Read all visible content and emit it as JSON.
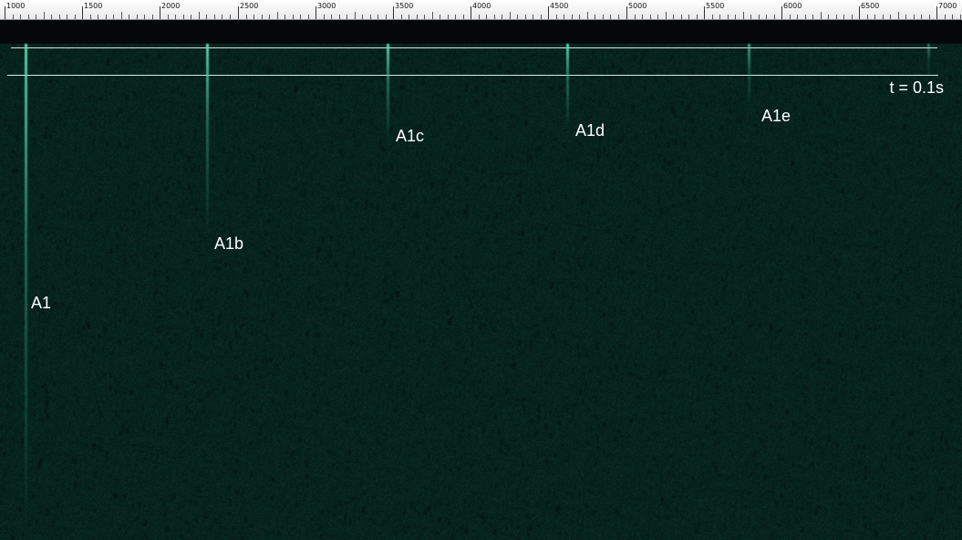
{
  "ruler": {
    "ticks": [
      "1000",
      "1500",
      "2000",
      "2500",
      "3000",
      "3500",
      "4000",
      "4500",
      "5000",
      "5500",
      "6000",
      "6500",
      "7000"
    ]
  },
  "time_label": "t = 0.1s",
  "peaks": [
    {
      "label": "A1"
    },
    {
      "label": "A1b"
    },
    {
      "label": "A1c"
    },
    {
      "label": "A1d"
    },
    {
      "label": "A1e"
    }
  ],
  "colors": {
    "background": "#0b2620",
    "streak": "#5ae6b4",
    "ruler": "#ffffff",
    "marker_line": "#d8e6e2"
  }
}
